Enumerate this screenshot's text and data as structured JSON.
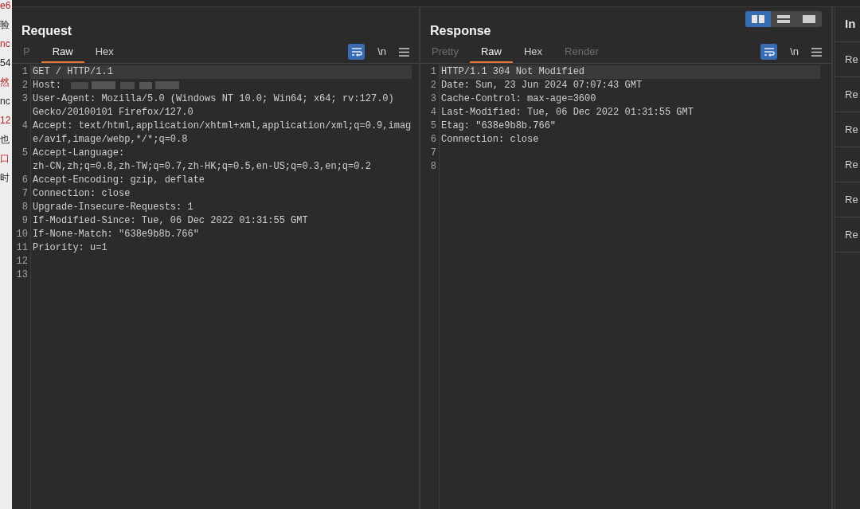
{
  "background_page": {
    "fragments": [
      "e6",
      "验",
      "nc",
      "54",
      "然",
      "nc",
      "12",
      "也",
      "口",
      "时"
    ]
  },
  "layout_toggle": [
    {
      "kind": "columns",
      "selected": true
    },
    {
      "kind": "rows",
      "selected": false
    },
    {
      "kind": "single",
      "selected": false
    }
  ],
  "request": {
    "title": "Request",
    "tabs": [
      {
        "label": "P",
        "selected": false,
        "dimmed": true
      },
      {
        "label": "Raw",
        "selected": true,
        "dimmed": false
      },
      {
        "label": "Hex",
        "selected": false,
        "dimmed": false
      }
    ],
    "toolbar": {
      "wrap_on": true,
      "newline_label": "\\n"
    },
    "lines": [
      {
        "number": "1",
        "text": "GET / HTTP/1.1",
        "current": true
      },
      {
        "number": "2",
        "text": "Host:",
        "current": false,
        "redacted": true
      },
      {
        "number": "3",
        "text": "User-Agent: Mozilla/5.0 (Windows NT 10.0; Win64; x64; rv:127.0) Gecko/20100101 Firefox/127.0",
        "current": false
      },
      {
        "number": "4",
        "text": "Accept: text/html,application/xhtml+xml,application/xml;q=0.9,image/avif,image/webp,*/*;q=0.8",
        "current": false
      },
      {
        "number": "5",
        "text": "Accept-Language: zh-CN,zh;q=0.8,zh-TW;q=0.7,zh-HK;q=0.5,en-US;q=0.3,en;q=0.2",
        "current": false
      },
      {
        "number": "6",
        "text": "Accept-Encoding: gzip, deflate",
        "current": false
      },
      {
        "number": "7",
        "text": "Connection: close",
        "current": false
      },
      {
        "number": "8",
        "text": "Upgrade-Insecure-Requests: 1",
        "current": false
      },
      {
        "number": "9",
        "text": "If-Modified-Since: Tue, 06 Dec 2022 01:31:55 GMT",
        "current": false
      },
      {
        "number": "10",
        "text": "If-None-Match: \"638e9b8b.766\"",
        "current": false
      },
      {
        "number": "11",
        "text": "Priority: u=1",
        "current": false
      },
      {
        "number": "12",
        "current": false
      },
      {
        "number": "13",
        "current": false
      }
    ]
  },
  "response": {
    "title": "Response",
    "tabs": [
      {
        "label": "Pretty",
        "selected": false,
        "dimmed": true
      },
      {
        "label": "Raw",
        "selected": true,
        "dimmed": false
      },
      {
        "label": "Hex",
        "selected": false,
        "dimmed": false
      },
      {
        "label": "Render",
        "selected": false,
        "dimmed": true
      }
    ],
    "toolbar": {
      "wrap_on": true,
      "newline_label": "\\n"
    },
    "lines": [
      {
        "number": "1",
        "text": "HTTP/1.1 304 Not Modified",
        "current": true
      },
      {
        "number": "2",
        "text": "Date: Sun, 23 Jun 2024 07:07:43 GMT",
        "current": false
      },
      {
        "number": "3",
        "text": "Cache-Control: max-age=3600",
        "current": false
      },
      {
        "number": "4",
        "text": "Last-Modified: Tue, 06 Dec 2022 01:31:55 GMT",
        "current": false
      },
      {
        "number": "5",
        "text": "Etag: \"638e9b8b.766\"",
        "current": false
      },
      {
        "number": "6",
        "text": "Connection: close",
        "current": false
      },
      {
        "number": "7",
        "current": false
      },
      {
        "number": "8",
        "current": false
      }
    ]
  },
  "inspector": {
    "title": "In",
    "items": [
      "Re",
      "Re",
      "Re",
      "Re",
      "Re",
      "Re"
    ]
  }
}
